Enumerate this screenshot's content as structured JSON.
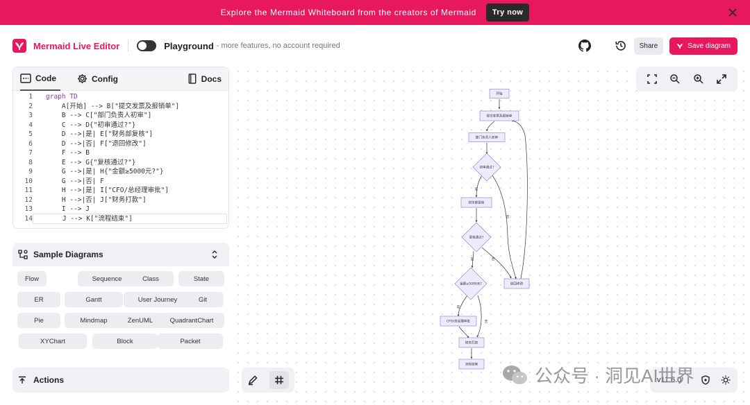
{
  "banner": {
    "text": "Explore the Mermaid Whiteboard from the creators of Mermaid",
    "button": "Try now"
  },
  "topbar": {
    "brand": "Mermaid Live Editor",
    "playground": "Playground",
    "playground_sub": "- more features, no account required",
    "share": "Share",
    "save": "Save diagram"
  },
  "editor": {
    "tabs": [
      "Code",
      "Config",
      "Docs"
    ],
    "lines": [
      {
        "n": "1",
        "t": "graph TD"
      },
      {
        "n": "2",
        "t": "    A[开始] --> B[\"提交发票及报销单\"]"
      },
      {
        "n": "3",
        "t": "    B --> C[\"部门负责人初审\"]"
      },
      {
        "n": "4",
        "t": "    C --> D{\"初审通过?\"}"
      },
      {
        "n": "5",
        "t": "    D -->|是| E[\"财务部复核\"]"
      },
      {
        "n": "6",
        "t": "    D -->|否| F[\"退回修改\"]"
      },
      {
        "n": "7",
        "t": "    F --> B"
      },
      {
        "n": "8",
        "t": "    E --> G{\"复核通过?\"}"
      },
      {
        "n": "9",
        "t": "    G -->|是| H{\"金额≥5000元?\"}"
      },
      {
        "n": "10",
        "t": "    G -->|否| F"
      },
      {
        "n": "11",
        "t": "    H -->|是| I[\"CFO/总经理审批\"]"
      },
      {
        "n": "12",
        "t": "    H -->|否| J[\"财务打款\"]"
      },
      {
        "n": "13",
        "t": "    I --> J"
      },
      {
        "n": "14",
        "t": "    J --> K[\"流程结束\"]"
      }
    ]
  },
  "samples": {
    "title": "Sample Diagrams",
    "items": [
      "Flow",
      "Sequence",
      "Class",
      "State",
      "ER",
      "Gantt",
      "User Journey",
      "Git",
      "Pie",
      "Mindmap",
      "ZenUML",
      "QuadrantChart",
      "XYChart",
      "Block",
      "Packet"
    ]
  },
  "actions": {
    "title": "Actions"
  },
  "version": "v11.6.0",
  "watermark": "公众号 · 洞见AI世界",
  "diagram": {
    "nodes": {
      "A": "开始",
      "B": "提交发票及报销单",
      "C": "部门负责人初审",
      "D": "初审通过?",
      "E": "财务部复核",
      "F": "退回修改",
      "G": "复核通过?",
      "H": "金额≥5000元?",
      "I": "CFO/总经理审批",
      "J": "财务打款",
      "K": "流程结束"
    },
    "edge_labels": {
      "yes": "是",
      "no": "否"
    }
  },
  "colors": {
    "accent": "#e8185f",
    "node_fill": "#ececff",
    "node_stroke": "#9370db"
  }
}
